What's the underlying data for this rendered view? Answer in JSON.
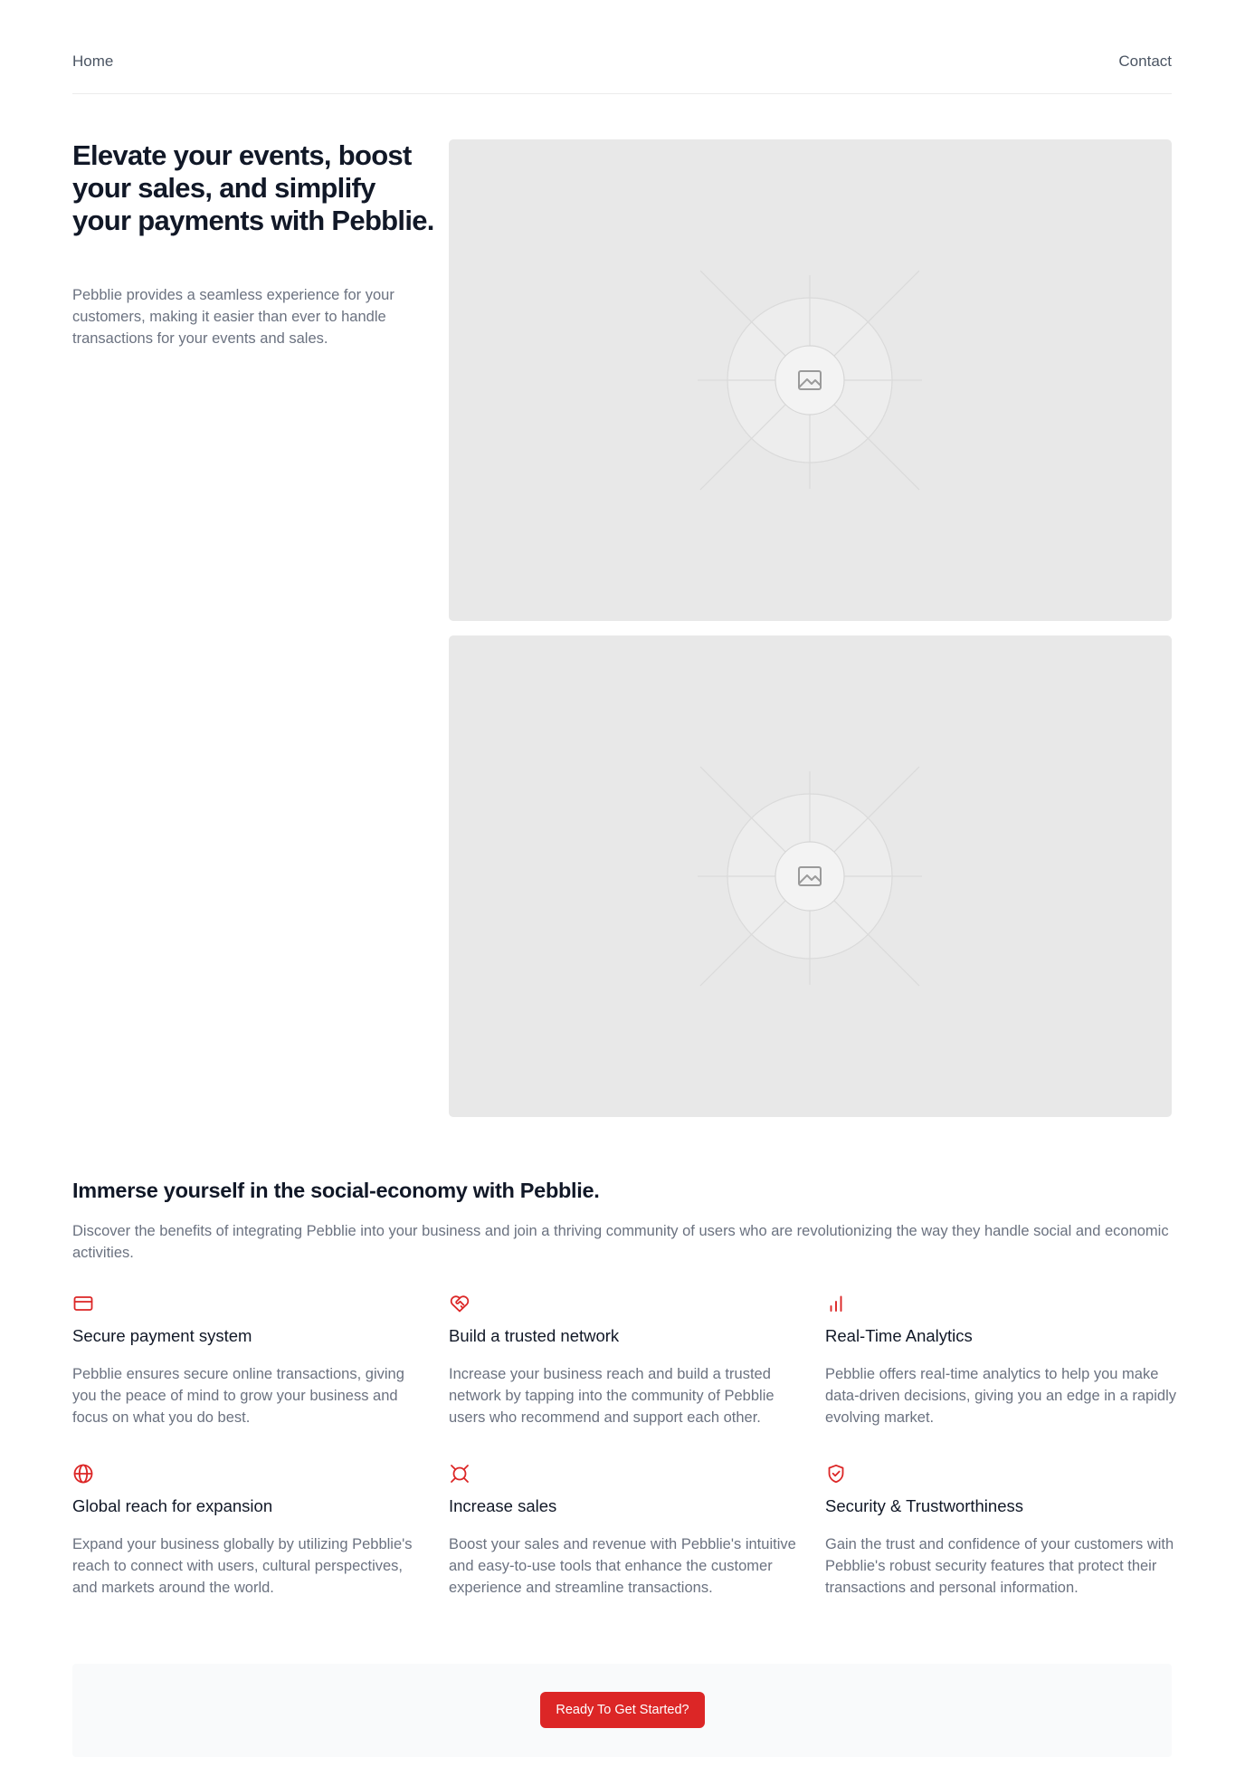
{
  "nav": {
    "home": "Home",
    "contact": "Contact"
  },
  "hero": {
    "title": "Elevate your events, boost your sales, and simplify your payments with Pebblie.",
    "description": "Pebblie provides a seamless experience for your customers, making it easier than ever to handle transactions for your events and sales."
  },
  "section": {
    "title": "Immerse yourself in the social-economy with Pebblie.",
    "description": "Discover the benefits of integrating Pebblie into your business and join a thriving community of users who are revolutionizing the way they handle social and economic activities."
  },
  "accent_color": "#dc2626",
  "features": [
    {
      "icon": "credit-card-icon",
      "title": "Secure payment system",
      "description": "Pebblie ensures secure online transactions, giving you the peace of mind to grow your business and focus on what you do best."
    },
    {
      "icon": "heart-handshake-icon",
      "title": "Build a trusted network",
      "description": "Increase your business reach and build a trusted network by tapping into the community of Pebblie users who recommend and support each other."
    },
    {
      "icon": "bar-chart-icon",
      "title": "Real-Time Analytics",
      "description": "Pebblie offers real-time analytics to help you make data-driven decisions, giving you an edge in a rapidly evolving market."
    },
    {
      "icon": "globe-icon",
      "title": "Global reach for expansion",
      "description": "Expand your business globally by utilizing Pebblie's reach to connect with users, cultural perspectives, and markets around the world."
    },
    {
      "icon": "sales-target-icon",
      "title": "Increase sales",
      "description": "Boost your sales and revenue with Pebblie's intuitive and easy-to-use tools that enhance the customer experience and streamline transactions."
    },
    {
      "icon": "shield-check-icon",
      "title": "Security & Trustworthiness",
      "description": "Gain the trust and confidence of your customers with Pebblie's robust security features that protect their transactions and personal information."
    }
  ],
  "cta": {
    "label": "Ready To Get Started?"
  }
}
